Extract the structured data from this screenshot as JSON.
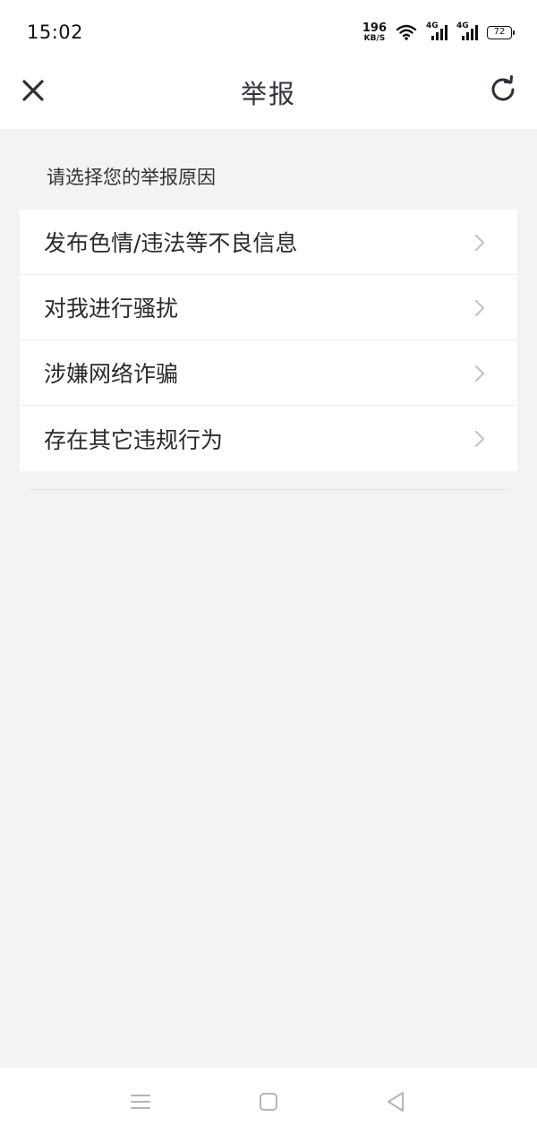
{
  "status": {
    "time": "15:02",
    "net_speed_value": "196",
    "net_speed_unit": "KB/S",
    "signal1_label": "4G",
    "signal2_label": "4G",
    "battery": "72",
    "icons": [
      "wifi-icon",
      "signal-icon",
      "battery-icon"
    ]
  },
  "header": {
    "title": "举报",
    "close_icon": "close-icon",
    "refresh_icon": "refresh-icon"
  },
  "prompt": "请选择您的举报原因",
  "reasons": [
    {
      "label": "发布色情/违法等不良信息"
    },
    {
      "label": "对我进行骚扰"
    },
    {
      "label": "涉嫌网络诈骗"
    },
    {
      "label": "存在其它违规行为"
    }
  ],
  "system_nav": [
    "menu-icon",
    "home-icon",
    "back-icon"
  ],
  "colors": {
    "background": "#f3f3f3",
    "surface": "#ffffff",
    "title": "#333340",
    "chevron": "#c4c4c4"
  }
}
